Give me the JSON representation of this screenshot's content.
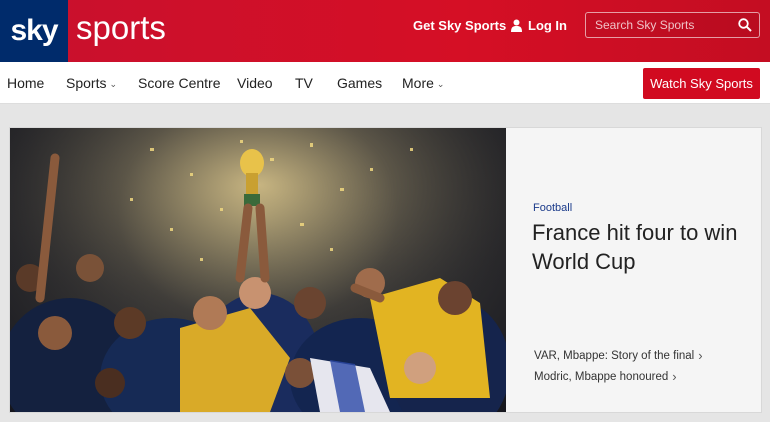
{
  "header": {
    "logo_sky": "sky",
    "logo_sports": "sports",
    "get_sky_label": "Get Sky Sports",
    "login_label": "Log In",
    "search_placeholder": "Search Sky Sports",
    "brand_color": "#c8102e",
    "logo_bg": "#002b6b"
  },
  "nav": {
    "items": [
      {
        "label": "Home",
        "chevron": false
      },
      {
        "label": "Sports",
        "chevron": true
      },
      {
        "label": "Score Centre",
        "chevron": false
      },
      {
        "label": "Video",
        "chevron": false
      },
      {
        "label": "TV",
        "chevron": false
      },
      {
        "label": "Games",
        "chevron": false
      },
      {
        "label": "More",
        "chevron": true
      }
    ],
    "watch_label": "Watch Sky Sports"
  },
  "hero": {
    "category": "Football",
    "headline": "France hit four to win World Cup",
    "related": [
      {
        "label": "VAR, Mbappe: Story of the final"
      },
      {
        "label": "Modric, Mbappe honoured"
      }
    ]
  },
  "icons": {
    "search": "search-icon",
    "user": "user-icon",
    "chevron": "chevron-icon"
  }
}
